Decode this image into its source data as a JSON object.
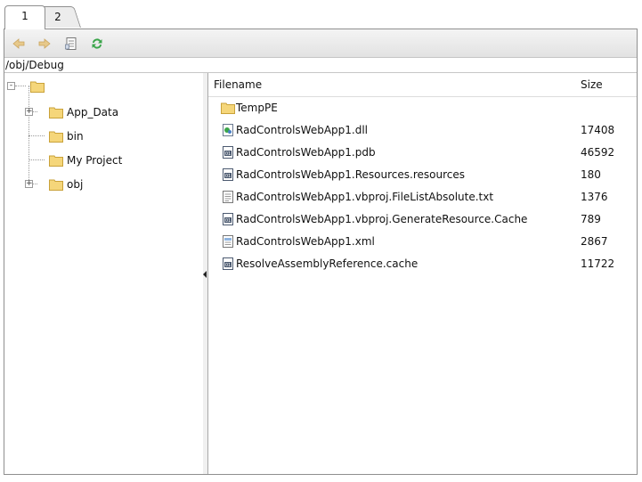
{
  "tabs": [
    {
      "label": "1",
      "active": true
    },
    {
      "label": "2",
      "active": false
    }
  ],
  "toolbar": {
    "buttons": [
      {
        "icon": "back-arrow-icon"
      },
      {
        "icon": "forward-arrow-icon"
      },
      {
        "icon": "properties-icon"
      },
      {
        "icon": "refresh-icon"
      }
    ]
  },
  "address": {
    "path": "/obj/Debug"
  },
  "tree": {
    "nodes": [
      {
        "label": "",
        "expander": "-",
        "icon": "folder-icon"
      },
      {
        "label": "App_Data",
        "expander": "+",
        "icon": "folder-icon"
      },
      {
        "label": "bin",
        "expander": "",
        "icon": "folder-icon"
      },
      {
        "label": "My Project",
        "expander": "",
        "icon": "folder-icon"
      },
      {
        "label": "obj",
        "expander": "+",
        "icon": "folder-icon"
      }
    ]
  },
  "grid": {
    "columns": {
      "filename": "Filename",
      "size": "Size"
    },
    "rows": [
      {
        "name": "TempPE",
        "size": "",
        "icon": "folder-icon"
      },
      {
        "name": "RadControlsWebApp1.dll",
        "size": "17408",
        "icon": "dll-icon"
      },
      {
        "name": "RadControlsWebApp1.pdb",
        "size": "46592",
        "icon": "binary-file-icon"
      },
      {
        "name": "RadControlsWebApp1.Resources.resources",
        "size": "180",
        "icon": "binary-file-icon"
      },
      {
        "name": "RadControlsWebApp1.vbproj.FileListAbsolute.txt",
        "size": "1376",
        "icon": "text-file-icon"
      },
      {
        "name": "RadControlsWebApp1.vbproj.GenerateResource.Cache",
        "size": "789",
        "icon": "binary-file-icon"
      },
      {
        "name": "RadControlsWebApp1.xml",
        "size": "2867",
        "icon": "xml-file-icon"
      },
      {
        "name": "ResolveAssemblyReference.cache",
        "size": "11722",
        "icon": "binary-file-icon"
      }
    ]
  },
  "colors": {
    "folder": "#f5d67a",
    "accent_green": "#3aa54a",
    "border": "#8f8f8f"
  }
}
